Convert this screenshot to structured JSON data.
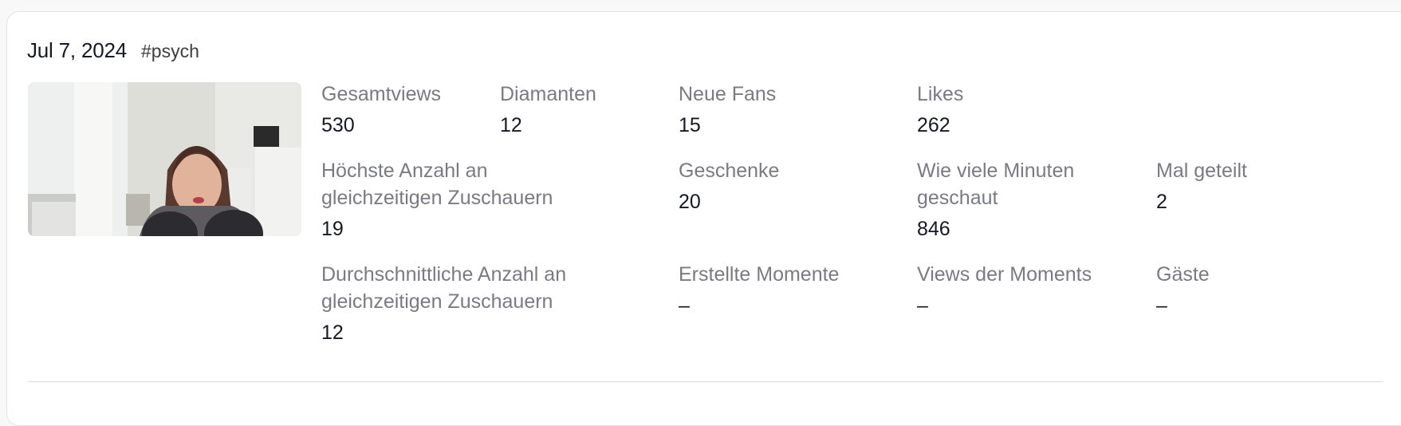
{
  "session": {
    "date": "Jul 7, 2024",
    "tag": "#psych"
  },
  "stats": {
    "gesamtviews": {
      "label": "Gesamtviews",
      "value": "530"
    },
    "diamanten": {
      "label": "Diamanten",
      "value": "12"
    },
    "neue_fans": {
      "label": "Neue Fans",
      "value": "15"
    },
    "likes": {
      "label": "Likes",
      "value": "262"
    },
    "hoechste_zuschauer": {
      "label_line1": "Höchste Anzahl an",
      "label_line2": "gleichzeitigen Zuschauern",
      "value": "19"
    },
    "geschenke": {
      "label": "Geschenke",
      "value": "20"
    },
    "minuten_geschaut": {
      "label_line1": "Wie viele Minuten",
      "label_line2": "geschaut",
      "value": "846"
    },
    "mal_geteilt": {
      "label": "Mal geteilt",
      "value": "2"
    },
    "durchschnitt_zuschauer": {
      "label_line1": "Durchschnittliche Anzahl an",
      "label_line2": "gleichzeitigen Zuschauern",
      "value": "12"
    },
    "erstellte_momente": {
      "label": "Erstellte Momente",
      "value": "–"
    },
    "views_moments": {
      "label": "Views der Moments",
      "value": "–"
    },
    "gaeste": {
      "label": "Gäste",
      "value": "–"
    }
  }
}
